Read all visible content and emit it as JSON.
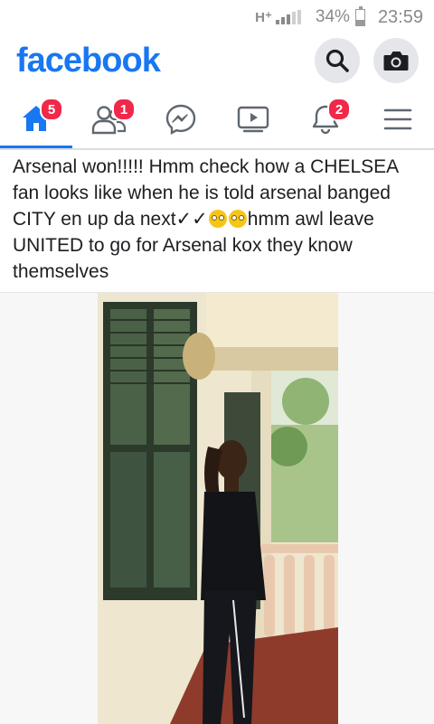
{
  "status_bar": {
    "network": "H⁺",
    "battery_pct": "34%",
    "battery_level": 0.34,
    "time": "23:59"
  },
  "header": {
    "logo": "facebook",
    "search_icon": "search-icon",
    "camera_icon": "camera-icon"
  },
  "tabs": [
    {
      "name": "home",
      "icon": "home-icon",
      "badge": "5",
      "active": true
    },
    {
      "name": "friends",
      "icon": "friends-icon",
      "badge": "1"
    },
    {
      "name": "messenger",
      "icon": "messenger-icon",
      "badge": ""
    },
    {
      "name": "watch",
      "icon": "video-icon",
      "badge": ""
    },
    {
      "name": "notifications",
      "icon": "bell-icon",
      "badge": "2"
    },
    {
      "name": "menu",
      "icon": "menu-icon",
      "badge": ""
    }
  ],
  "colors": {
    "brand": "#1877f2",
    "badge": "#f02849",
    "icon_gray": "#606770"
  },
  "post": {
    "text_part1": "Arsenal won!!!!! Hmm check how a CHELSEA fan looks like when he is told arsenal banged CITY en up da next✓✓",
    "text_part2": "hmm awl leave UNITED to go for Arsenal kox they know themselves",
    "emoji": "rolling-eyes-emoji"
  }
}
